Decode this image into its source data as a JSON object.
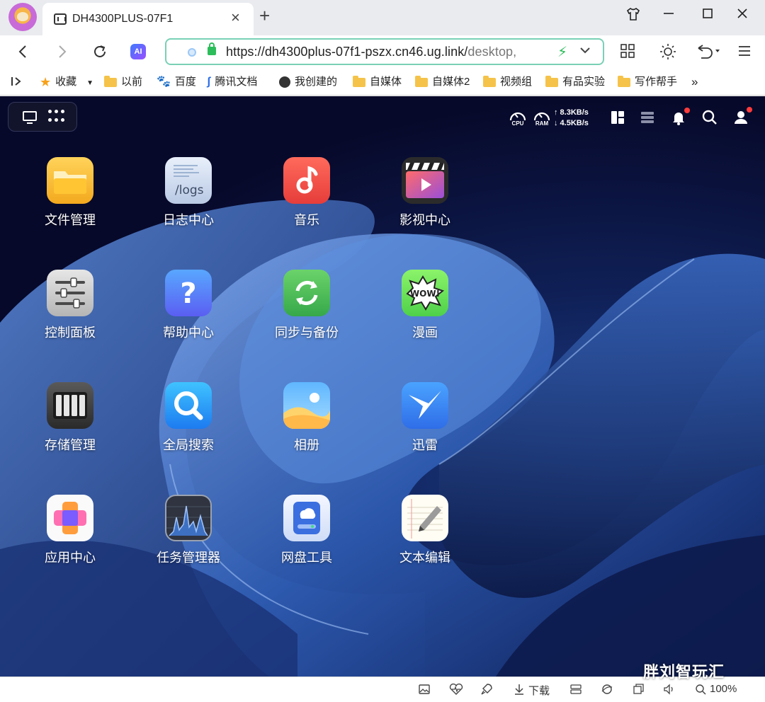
{
  "browser": {
    "tab_title": "DH4300PLUS-07F1",
    "tab_close": "×",
    "new_tab": "+",
    "url_main": "https://dh4300plus-07f1-pszx.cn46.ug.link/",
    "url_tail": "desktop,",
    "ai_label": "AI",
    "bookmarks": [
      {
        "label": "收藏",
        "icon": "star-icon"
      },
      {
        "label": "以前",
        "icon": "folder-icon"
      },
      {
        "label": "百度",
        "icon": "baidu-paw-icon"
      },
      {
        "label": "腾讯文档",
        "icon": "tencent-docs-icon"
      },
      {
        "label": "我创建的",
        "icon": "sphere-icon"
      },
      {
        "label": "自媒体",
        "icon": "folder-icon"
      },
      {
        "label": "自媒体2",
        "icon": "folder-icon"
      },
      {
        "label": "视频组",
        "icon": "folder-icon"
      },
      {
        "label": "有品实验",
        "icon": "folder-icon"
      },
      {
        "label": "写作帮手",
        "icon": "folder-icon"
      }
    ],
    "bookmarks_more": "»"
  },
  "nas": {
    "cpu_label": "CPU",
    "ram_label": "RAM",
    "upload_speed": "↑ 8.3KB/s",
    "download_speed": "↓ 4.5KB/s",
    "apps": [
      {
        "label": "文件管理",
        "icon": "folder-app-icon"
      },
      {
        "label": "日志中心",
        "icon": "logs-app-icon",
        "icon_text": "/logs"
      },
      {
        "label": "音乐",
        "icon": "music-app-icon"
      },
      {
        "label": "影视中心",
        "icon": "video-app-icon"
      },
      {
        "label": "控制面板",
        "icon": "control-panel-app-icon"
      },
      {
        "label": "帮助中心",
        "icon": "help-app-icon",
        "icon_text": "?"
      },
      {
        "label": "同步与备份",
        "icon": "sync-backup-app-icon"
      },
      {
        "label": "漫画",
        "icon": "comic-app-icon",
        "icon_text": "WOW!"
      },
      {
        "label": "存储管理",
        "icon": "storage-app-icon"
      },
      {
        "label": "全局搜索",
        "icon": "search-app-icon"
      },
      {
        "label": "相册",
        "icon": "photos-app-icon"
      },
      {
        "label": "迅雷",
        "icon": "thunder-app-icon"
      },
      {
        "label": "应用中心",
        "icon": "app-center-icon"
      },
      {
        "label": "任务管理器",
        "icon": "task-manager-app-icon"
      },
      {
        "label": "网盘工具",
        "icon": "cloud-drive-app-icon"
      },
      {
        "label": "文本编辑",
        "icon": "text-editor-app-icon"
      }
    ]
  },
  "statusbar": {
    "download_label": "下载",
    "zoom": "100%"
  },
  "watermark": "胖刘智玩汇"
}
